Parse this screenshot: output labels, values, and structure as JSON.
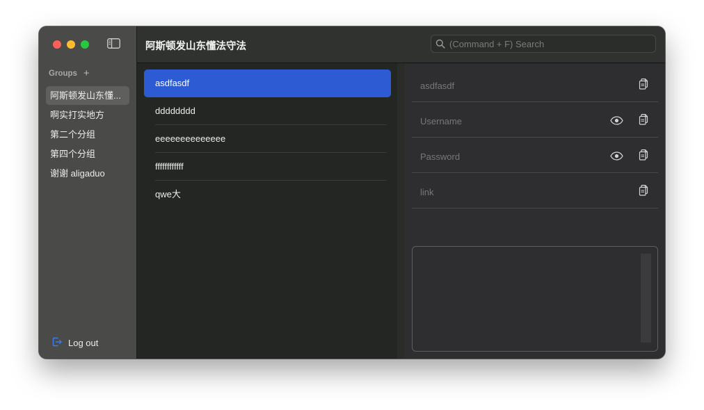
{
  "sidebar": {
    "groups_label": "Groups",
    "add_symbol": "+",
    "items": [
      {
        "label": "阿斯顿发山东懂..."
      },
      {
        "label": "啊实打实地方"
      },
      {
        "label": "第二个分组"
      },
      {
        "label": "第四个分组"
      },
      {
        "label": "谢谢 aligaduo"
      }
    ],
    "logout_label": "Log out"
  },
  "header": {
    "title": "阿斯顿发山东懂法守法",
    "search_placeholder": "(Command + F) Search"
  },
  "entries": [
    {
      "label": "asdfasdf"
    },
    {
      "label": "dddddddd"
    },
    {
      "label": "eeeeeeeeeeeeee"
    },
    {
      "label": "ffffffffffff"
    },
    {
      "label": "qwe大"
    }
  ],
  "detail": {
    "title_placeholder": "asdfasdf",
    "username_placeholder": "Username",
    "password_placeholder": "Password",
    "link_placeholder": "link"
  },
  "colors": {
    "accent": "#2c5bd4",
    "close": "#fe5f57",
    "minimize": "#febc2e",
    "maximize": "#28c840"
  },
  "icons": [
    "sidebar-toggle-icon",
    "plus-icon",
    "logout-icon",
    "search-icon",
    "copy-icon",
    "eye-icon",
    "edit-icon",
    "close-circle-icon"
  ]
}
